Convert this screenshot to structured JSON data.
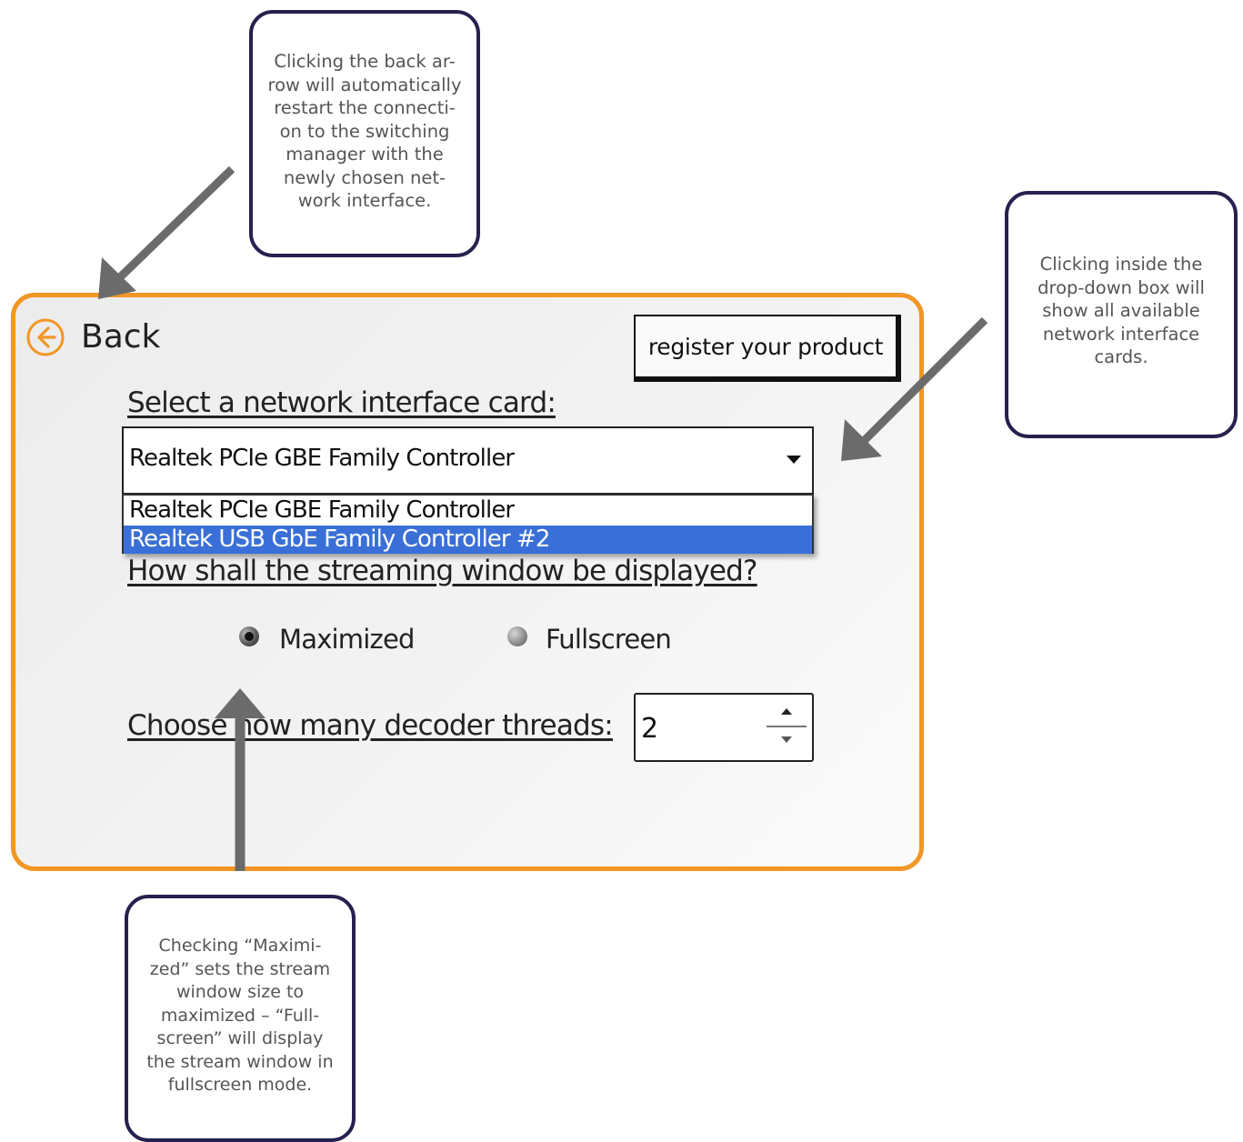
{
  "callouts": {
    "back": "Clicking the back ar-\nrow will automatically\nrestart the connecti-\non to the switching\nmanager with the\nnewly chosen net-\nwork interface.",
    "dropdown": "Clicking inside the\ndrop-down box will\nshow all available\nnetwork interface\ncards.",
    "maximized": "Checking “Maximi-\nzed” sets the stream\nwindow size to\nmaximized – “Full-\nscreen” will display\nthe stream window in\nfullscreen mode."
  },
  "header": {
    "back_label": "Back",
    "back_icon": "arrow-left-circle-icon",
    "register_label": "register your product"
  },
  "nic": {
    "label": "Select a network interface card:",
    "selected": "Realtek PCIe GBE Family Controller",
    "options": [
      "Realtek PCIe GBE Family Controller",
      "Realtek USB GbE Family Controller #2"
    ],
    "highlighted_index": 1
  },
  "display": {
    "label": "How shall the streaming window be displayed?",
    "options": [
      "Maximized",
      "Fullscreen"
    ],
    "selected": "Maximized"
  },
  "threads": {
    "label": "Choose how many decoder threads:",
    "value": "2"
  },
  "colors": {
    "panel_border": "#f29625",
    "callout_border": "#25214f",
    "selection_highlight": "#3a6fd8",
    "arrow": "#6b6b6b"
  }
}
